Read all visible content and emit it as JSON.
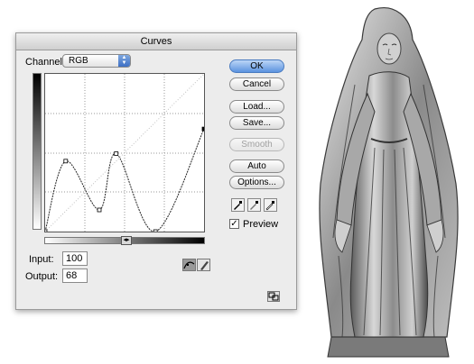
{
  "dialog": {
    "title": "Curves",
    "channel_label": "Channel:",
    "channel_value": "RGB",
    "input_label": "Input:",
    "input_value": "100",
    "output_label": "Output:",
    "output_value": "68"
  },
  "buttons": {
    "ok": "OK",
    "cancel": "Cancel",
    "load": "Load...",
    "save": "Save...",
    "smooth": "Smooth",
    "auto": "Auto",
    "options": "Options..."
  },
  "preview": {
    "label": "Preview",
    "checked": true
  },
  "icons": {
    "channel_arrows": "up-down-arrows-icon",
    "black_eyedropper": "eyedropper-black-icon",
    "gray_eyedropper": "eyedropper-gray-icon",
    "white_eyedropper": "eyedropper-white-icon",
    "curve_tool": "curve-point-tool-icon",
    "pencil_tool": "pencil-tool-icon",
    "expand": "expand-view-icon"
  },
  "curve": {
    "input_range": [
      0,
      255
    ],
    "output_range": [
      0,
      255
    ],
    "control_points": [
      [
        0,
        0
      ],
      [
        33,
        114
      ],
      [
        87,
        35
      ],
      [
        114,
        126
      ],
      [
        177,
        0
      ],
      [
        255,
        166
      ]
    ]
  },
  "colors": {
    "default_button": "#5b93df",
    "dialog_bg": "#ececec"
  }
}
